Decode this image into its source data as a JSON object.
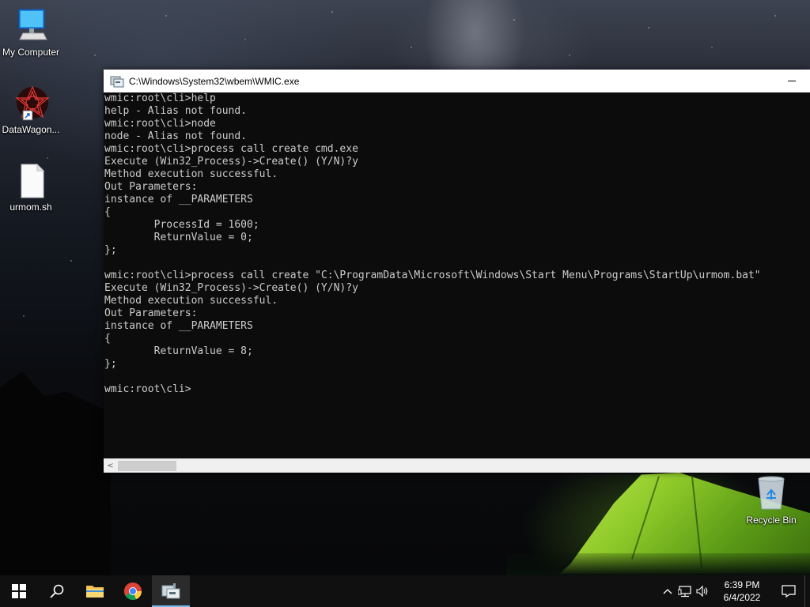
{
  "desktop": {
    "icons": [
      {
        "label": "My Computer",
        "icon": "monitor-icon"
      },
      {
        "label": "DataWagon...",
        "icon": "datawagon-shortcut-icon"
      },
      {
        "label": "urmom.sh",
        "icon": "file-icon"
      },
      {
        "label": "Recycle Bin",
        "icon": "recycle-bin-icon"
      }
    ]
  },
  "window": {
    "title": "C:\\Windows\\System32\\wbem\\WMIC.exe",
    "console_lines": [
      "wmic:root\\cli>help",
      "help - Alias not found.",
      "wmic:root\\cli>node",
      "node - Alias not found.",
      "wmic:root\\cli>process call create cmd.exe",
      "Execute (Win32_Process)->Create() (Y/N)?y",
      "Method execution successful.",
      "Out Parameters:",
      "instance of __PARAMETERS",
      "{",
      "        ProcessId = 1600;",
      "        ReturnValue = 0;",
      "};",
      "",
      "wmic:root\\cli>process call create \"C:\\ProgramData\\Microsoft\\Windows\\Start Menu\\Programs\\StartUp\\urmom.bat\"",
      "Execute (Win32_Process)->Create() (Y/N)?y",
      "Method execution successful.",
      "Out Parameters:",
      "instance of __PARAMETERS",
      "{",
      "        ReturnValue = 8;",
      "};",
      "",
      "wmic:root\\cli>"
    ],
    "scroll_left_glyph": "<"
  },
  "taskbar": {
    "items": [
      {
        "name": "start-button",
        "icon": "windows-logo-icon"
      },
      {
        "name": "search-button",
        "icon": "search-icon"
      },
      {
        "name": "file-explorer-button",
        "icon": "folder-icon"
      },
      {
        "name": "chrome-button",
        "icon": "chrome-icon"
      },
      {
        "name": "wmic-button",
        "icon": "wmic-app-icon",
        "active": true
      }
    ],
    "tray": {
      "time": "6:39 PM",
      "date": "6/4/2022"
    }
  },
  "colors": {
    "console_bg": "#0c0c0c",
    "console_fg": "#cccccc",
    "taskbar_bg": "#101010",
    "active_indicator": "#76b9ed"
  }
}
